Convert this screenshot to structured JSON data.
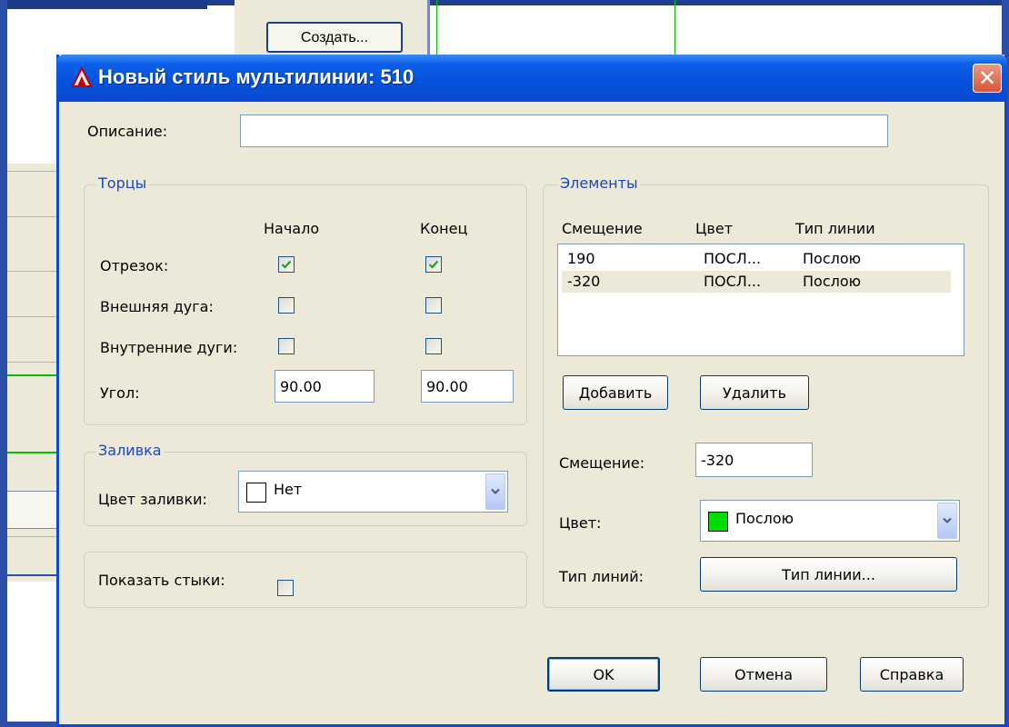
{
  "background": {
    "create_button": "Создать..."
  },
  "dialog": {
    "title": "Новый стиль мультилинии: 510",
    "close_symbol": "✕",
    "description_label": "Описание:",
    "description_value": "",
    "caps": {
      "title": "Торцы",
      "col_start": "Начало",
      "col_end": "Конец",
      "rows": [
        {
          "label": "Отрезок:",
          "start": true,
          "end": true
        },
        {
          "label": "Внешняя дуга:",
          "start": false,
          "end": false
        },
        {
          "label": "Внутренние дуги:",
          "start": false,
          "end": false
        }
      ],
      "angle_label": "Угол:",
      "angle_start": "90.00",
      "angle_end": "90.00"
    },
    "fill": {
      "title": "Заливка",
      "color_label": "Цвет заливки:",
      "color_value": "Нет",
      "color_swatch": "#ffffff"
    },
    "show_joints": {
      "label": "Показать стыки:",
      "checked": false
    },
    "elements": {
      "title": "Элементы",
      "columns": [
        "Смещение",
        "Цвет",
        "Тип линии"
      ],
      "rows": [
        {
          "offset": "190",
          "color": "ПОСЛ...",
          "linetype": "Послою"
        },
        {
          "offset": "-320",
          "color": "ПОСЛ...",
          "linetype": "Послою"
        }
      ],
      "add_button": "Добавить",
      "delete_button": "Удалить",
      "offset_label": "Смещение:",
      "offset_value": "-320",
      "color_label": "Цвет:",
      "color_value": "Послою",
      "color_swatch": "#00dd00",
      "linetype_label": "Тип линий:",
      "linetype_button": "Тип линии..."
    },
    "buttons": {
      "ok": "OK",
      "cancel": "Отмена",
      "help": "Справка"
    }
  },
  "colors": {
    "title_bar": "#0551dc",
    "dialog_bg": "#ece9d8",
    "group_title": "#1c48b8",
    "close_button": "#d7553a"
  }
}
